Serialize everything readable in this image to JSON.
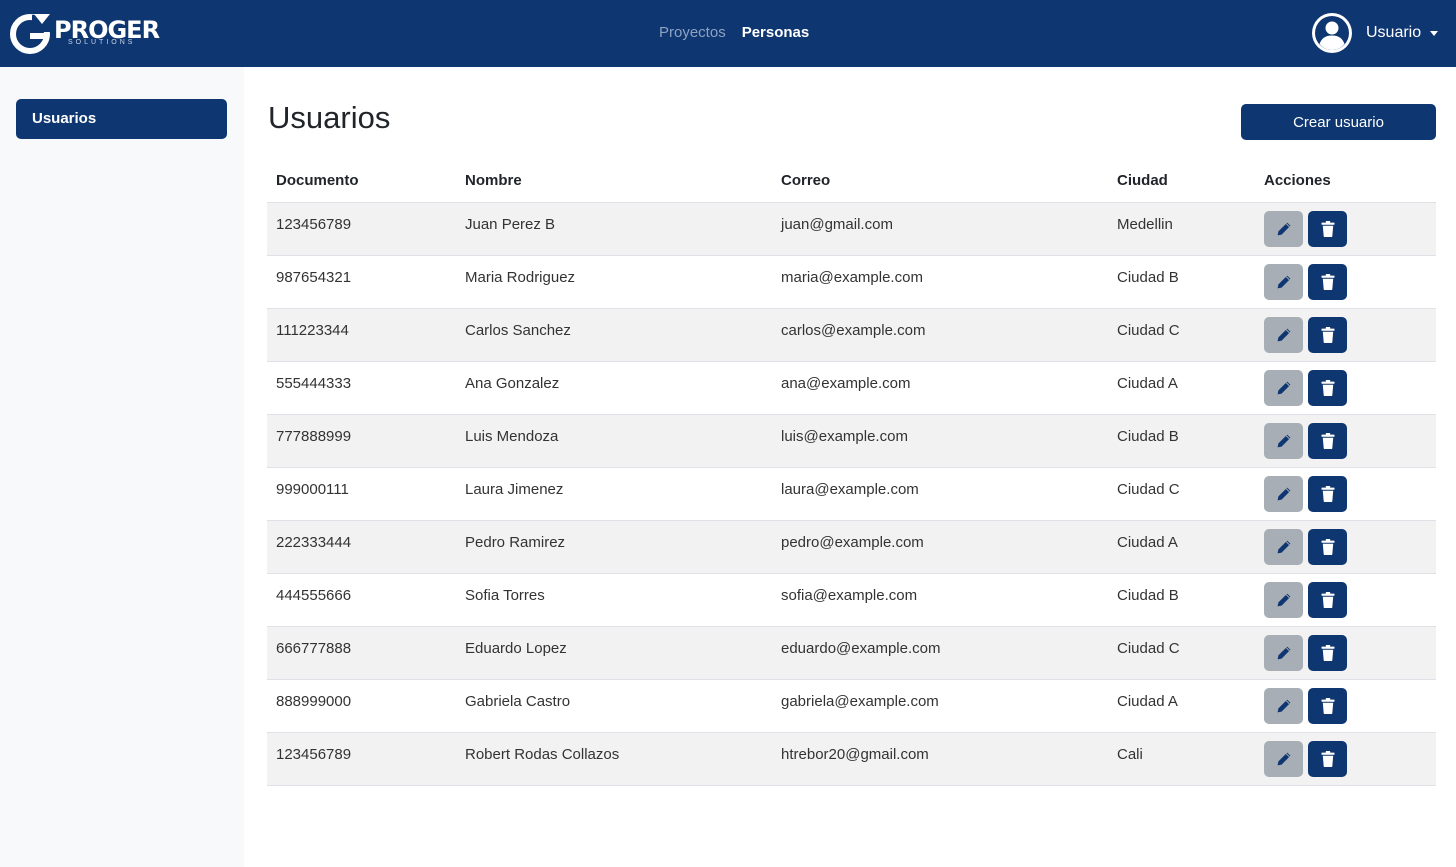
{
  "brand": {
    "name": "PROGER",
    "subtitle": "SOLUTIONS"
  },
  "nav": {
    "links": [
      {
        "label": "Proyectos"
      },
      {
        "label": "Personas"
      }
    ],
    "active": "Personas"
  },
  "user_menu": {
    "label": "Usuario"
  },
  "sidebar": {
    "items": [
      {
        "label": "Usuarios"
      }
    ]
  },
  "main": {
    "title": "Usuarios",
    "create_label": "Crear usuario"
  },
  "table": {
    "headers": [
      "Documento",
      "Nombre",
      "Correo",
      "Ciudad",
      "Acciones"
    ],
    "rows": [
      {
        "documento": "123456789",
        "nombre": "Juan Perez B",
        "correo": "juan@gmail.com",
        "ciudad": "Medellin"
      },
      {
        "documento": "987654321",
        "nombre": "Maria Rodriguez",
        "correo": "maria@example.com",
        "ciudad": "Ciudad B"
      },
      {
        "documento": "111223344",
        "nombre": "Carlos Sanchez",
        "correo": "carlos@example.com",
        "ciudad": "Ciudad C"
      },
      {
        "documento": "555444333",
        "nombre": "Ana Gonzalez",
        "correo": "ana@example.com",
        "ciudad": "Ciudad A"
      },
      {
        "documento": "777888999",
        "nombre": "Luis Mendoza",
        "correo": "luis@example.com",
        "ciudad": "Ciudad B"
      },
      {
        "documento": "999000111",
        "nombre": "Laura Jimenez",
        "correo": "laura@example.com",
        "ciudad": "Ciudad C"
      },
      {
        "documento": "222333444",
        "nombre": "Pedro Ramirez",
        "correo": "pedro@example.com",
        "ciudad": "Ciudad A"
      },
      {
        "documento": "444555666",
        "nombre": "Sofia Torres",
        "correo": "sofia@example.com",
        "ciudad": "Ciudad B"
      },
      {
        "documento": "666777888",
        "nombre": "Eduardo Lopez",
        "correo": "eduardo@example.com",
        "ciudad": "Ciudad C"
      },
      {
        "documento": "888999000",
        "nombre": "Gabriela Castro",
        "correo": "gabriela@example.com",
        "ciudad": "Ciudad A"
      },
      {
        "documento": "123456789",
        "nombre": "Robert Rodas Collazos",
        "correo": "htrebor20@gmail.com",
        "ciudad": "Cali"
      }
    ]
  },
  "icons": {
    "logo": "proger-logo-icon",
    "avatar": "user-circle-icon",
    "edit": "pencil-icon",
    "delete": "trash-icon",
    "caret": "caret-down-icon"
  },
  "colors": {
    "primary": "#0e3670",
    "edit_button": "#a8aeb6",
    "stripe": "#f2f2f2",
    "sidebar_bg": "#f8f9fb"
  }
}
